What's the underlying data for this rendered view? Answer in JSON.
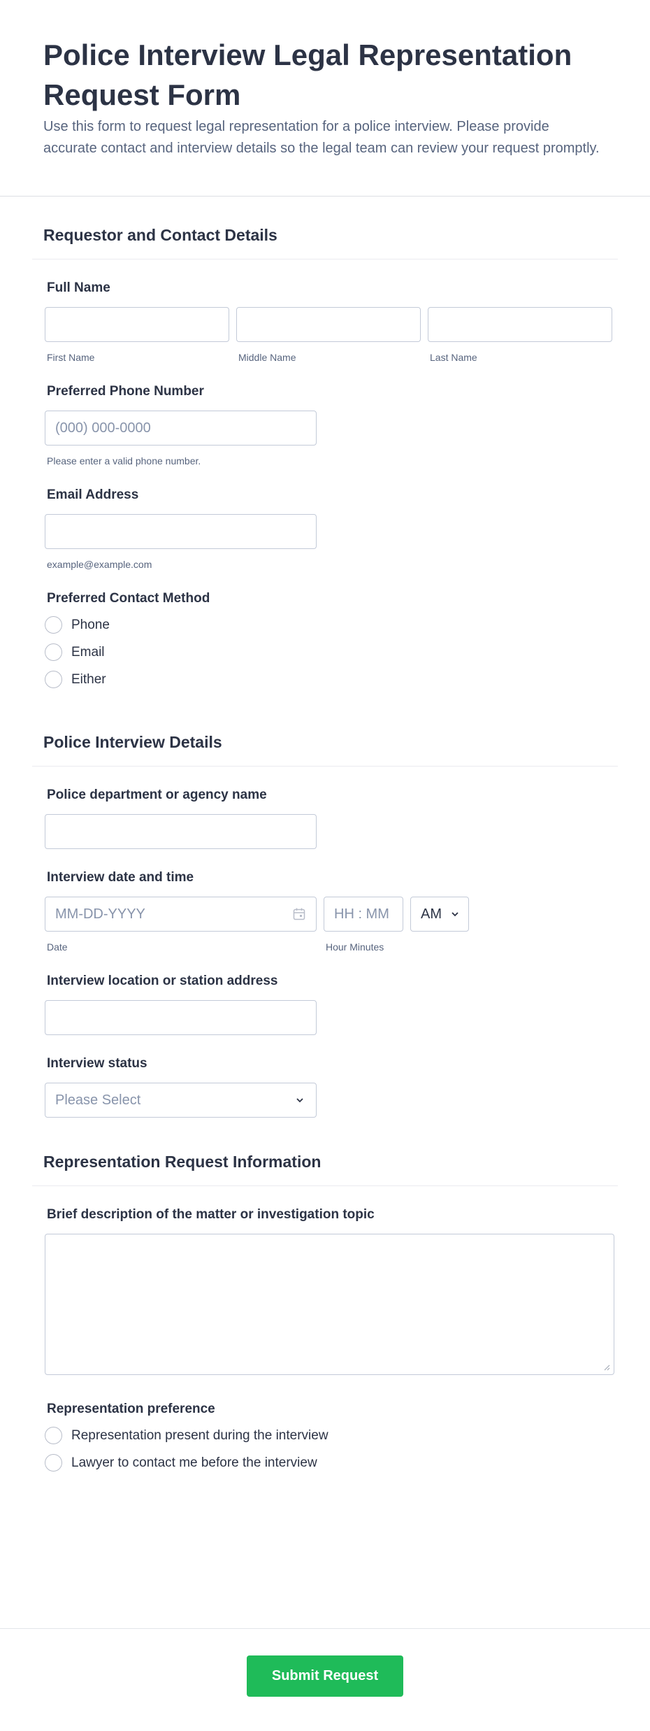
{
  "header": {
    "title": "Police Interview Legal Representation Request Form",
    "description": "Use this form to request legal representation for a police interview. Please provide accurate contact and interview details so the legal team can review your request promptly."
  },
  "sections": {
    "contact": {
      "title": "Requestor and Contact Details",
      "full_name": {
        "label": "Full Name",
        "first": "First Name",
        "middle": "Middle Name",
        "last": "Last Name"
      },
      "phone": {
        "label": "Preferred Phone Number",
        "placeholder": "(000) 000-0000",
        "hint": "Please enter a valid phone number."
      },
      "email": {
        "label": "Email Address",
        "hint": "example@example.com"
      },
      "contact_method": {
        "label": "Preferred Contact Method",
        "options": [
          "Phone",
          "Email",
          "Either"
        ]
      }
    },
    "interview": {
      "title": "Police Interview Details",
      "agency": {
        "label": "Police department or agency name"
      },
      "datetime": {
        "label": "Interview date and time",
        "date_placeholder": "MM-DD-YYYY",
        "date_sub": "Date",
        "time_placeholder": "HH : MM",
        "time_sub": "Hour Minutes",
        "ampm_value": "AM"
      },
      "location": {
        "label": "Interview location or station address"
      },
      "status": {
        "label": "Interview status",
        "placeholder": "Please Select"
      }
    },
    "representation": {
      "title": "Representation Request Information",
      "description": {
        "label": "Brief description of the matter or investigation topic"
      },
      "preference": {
        "label": "Representation preference",
        "options": [
          "Representation present during the interview",
          "Lawyer to contact me before the interview"
        ]
      }
    }
  },
  "footer": {
    "submit_label": "Submit Request"
  },
  "colors": {
    "accent": "#1fbb59",
    "text": "#2c3345",
    "muted": "#57647e",
    "border": "#c3cad8"
  }
}
